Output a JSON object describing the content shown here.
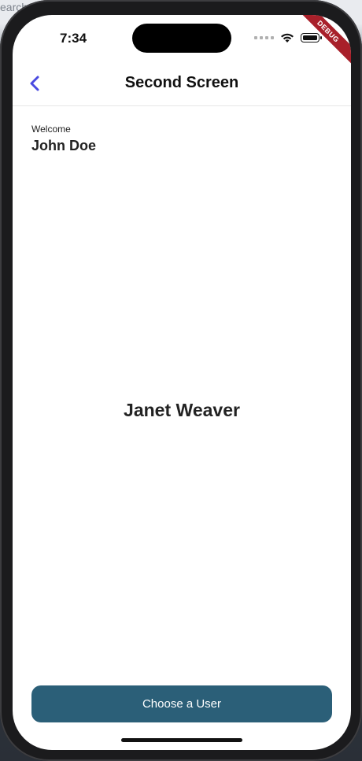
{
  "background": {
    "partial_text": "earch"
  },
  "status_bar": {
    "time": "7:34"
  },
  "debug_banner": {
    "label": "DEBUG",
    "color": "#a8202a"
  },
  "app_bar": {
    "title": "Second Screen",
    "back_icon": "chevron-left-icon",
    "accent": "#4a4ae0"
  },
  "welcome": {
    "label": "Welcome",
    "name": "John Doe"
  },
  "selected_user": {
    "name": "Janet Weaver"
  },
  "choose_button": {
    "label": "Choose a User",
    "color": "#2b5f78"
  }
}
